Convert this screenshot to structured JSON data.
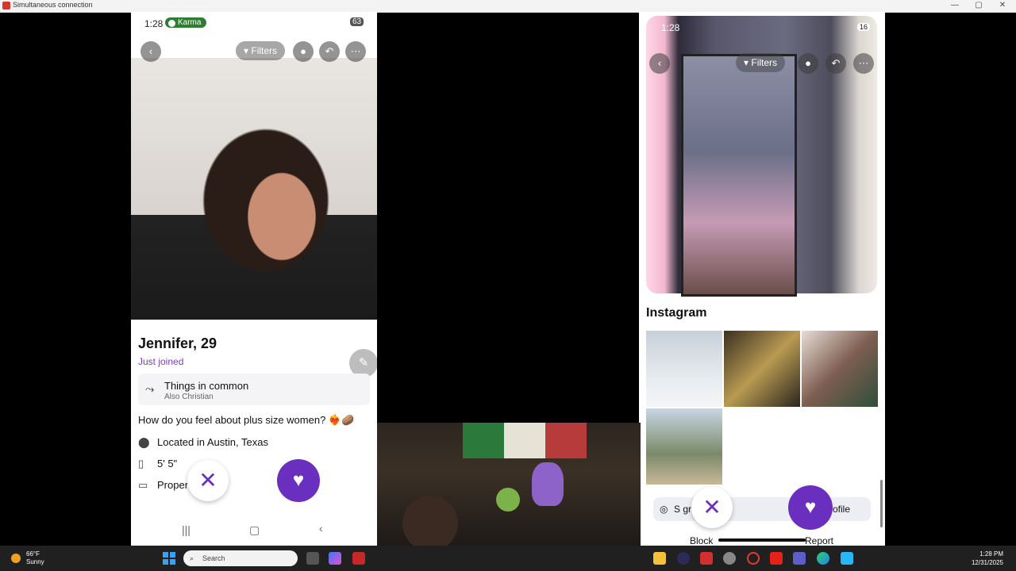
{
  "window": {
    "title": "Simultaneous connection",
    "minimize": "—",
    "maximize": "▢",
    "close": "✕"
  },
  "left_phone": {
    "status": {
      "time": "1:28",
      "karma_badge": "Karma",
      "battery": "63"
    },
    "nav": {
      "filters_label": "Filters"
    },
    "profile": {
      "name": "Jennifer, 29",
      "joined": "Just joined",
      "common_title": "Things in common",
      "common_sub": "Also Christian",
      "question": "How do you feel about plus size women? ❤️‍🔥🥔",
      "location": "Located in Austin, Texas",
      "height": "5' 5\"",
      "job": "Proper        ger"
    }
  },
  "right_phone": {
    "status": {
      "time": "1:28",
      "battery": "16"
    },
    "nav": {
      "filters_label": "Filters"
    },
    "instagram_title": "Instagram",
    "see_posts": "S          gram posts",
    "profile_suffix": "ofile",
    "block": "Block",
    "report": "Report"
  },
  "taskbar": {
    "temp": "66°F",
    "condition": "Sunny",
    "search_placeholder": "Search",
    "time": "1:28 PM",
    "date": "12/31/2025"
  },
  "colors": {
    "accent": "#6b2fc0",
    "karma": "#2e7d32"
  }
}
